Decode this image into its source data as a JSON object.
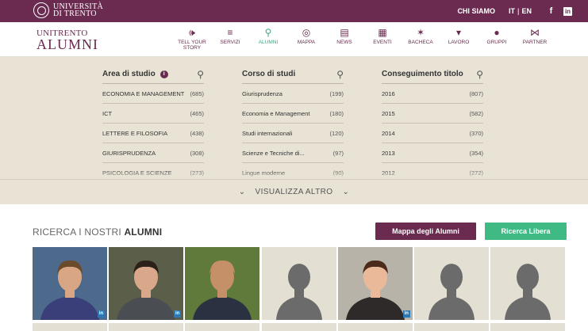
{
  "topbar": {
    "university": [
      "UNIVERSITÀ",
      "DI TRENTO"
    ],
    "chi_siamo": "CHI SIAMO",
    "lang_it": "IT",
    "lang_sep": "|",
    "lang_en": "EN",
    "facebook": "f",
    "linkedin": "in"
  },
  "logo": {
    "line1": "UNITRENTO",
    "line2": "ALUMNI"
  },
  "nav": [
    {
      "label": "TELL YOUR STORY",
      "icon": "megaphone-icon",
      "active": false
    },
    {
      "label": "SERVIZI",
      "icon": "wifi-icon",
      "active": false
    },
    {
      "label": "ALUMNI",
      "icon": "search-icon",
      "active": true
    },
    {
      "label": "MAPPA",
      "icon": "globe-icon",
      "active": false
    },
    {
      "label": "NEWS",
      "icon": "chat-icon",
      "active": false
    },
    {
      "label": "EVENTI",
      "icon": "calendar-icon",
      "active": false
    },
    {
      "label": "BACHECA",
      "icon": "pin-icon",
      "active": false
    },
    {
      "label": "LAVORO",
      "icon": "tie-icon",
      "active": false
    },
    {
      "label": "GRUPPI",
      "icon": "group-icon",
      "active": false
    },
    {
      "label": "PARTNER",
      "icon": "handshake-icon",
      "active": false
    }
  ],
  "filters": {
    "area": {
      "title": "Area di studio",
      "info": "i",
      "items": [
        {
          "label": "ECONOMIA E MANAGEMENT",
          "count": "(685)"
        },
        {
          "label": "ICT",
          "count": "(465)"
        },
        {
          "label": "LETTERE E FILOSOFIA",
          "count": "(438)"
        },
        {
          "label": "GIURISPRUDENZA",
          "count": "(308)"
        },
        {
          "label": "PSICOLOGIA E SCIENZE",
          "count": "(273)"
        }
      ]
    },
    "corso": {
      "title": "Corso di studi",
      "items": [
        {
          "label": "Giurisprudenza",
          "count": "(199)"
        },
        {
          "label": "Economia e Management",
          "count": "(180)"
        },
        {
          "label": "Studi internazionali",
          "count": "(120)"
        },
        {
          "label": "Scienze e Tecniche di...",
          "count": "(97)"
        },
        {
          "label": "Lingue moderne",
          "count": "(90)"
        }
      ]
    },
    "anno": {
      "title": "Conseguimento titolo",
      "items": [
        {
          "label": "2016",
          "count": "(807)"
        },
        {
          "label": "2015",
          "count": "(582)"
        },
        {
          "label": "2014",
          "count": "(370)"
        },
        {
          "label": "2013",
          "count": "(354)"
        },
        {
          "label": "2012",
          "count": "(272)"
        }
      ]
    },
    "more_label": "VISUALIZZA ALTRO"
  },
  "search": {
    "title_prefix": "RICERCA I NOSTRI",
    "title_bold": "ALUMNI",
    "map_button": "Mappa degli Alumni",
    "free_button": "Ricerca Libera"
  },
  "alumni": [
    {
      "photo": true,
      "skin": "#d8a684",
      "hair": "#6b4a2b",
      "shirt": "#3a3f7a",
      "bg": "#4d6a8c",
      "linkedin": true
    },
    {
      "photo": true,
      "skin": "#d9a78a",
      "hair": "#2b2118",
      "shirt": "#4a4e52",
      "bg": "#5b5e48",
      "linkedin": true
    },
    {
      "photo": true,
      "skin": "#c59067",
      "hair": "#c59067",
      "shirt": "#2a3242",
      "bg": "#5f7a3a",
      "linkedin": false
    },
    {
      "photo": false,
      "linkedin": false
    },
    {
      "photo": true,
      "skin": "#e9b99a",
      "hair": "#4a2a1a",
      "shirt": "#2f2a2a",
      "bg": "#b7b3a8",
      "linkedin": true
    },
    {
      "photo": false,
      "linkedin": false
    },
    {
      "photo": false,
      "linkedin": false
    }
  ],
  "colors": {
    "primary": "#6b2a4f",
    "accent_green": "#3fba85",
    "panel_bg": "#e8e3d5"
  }
}
